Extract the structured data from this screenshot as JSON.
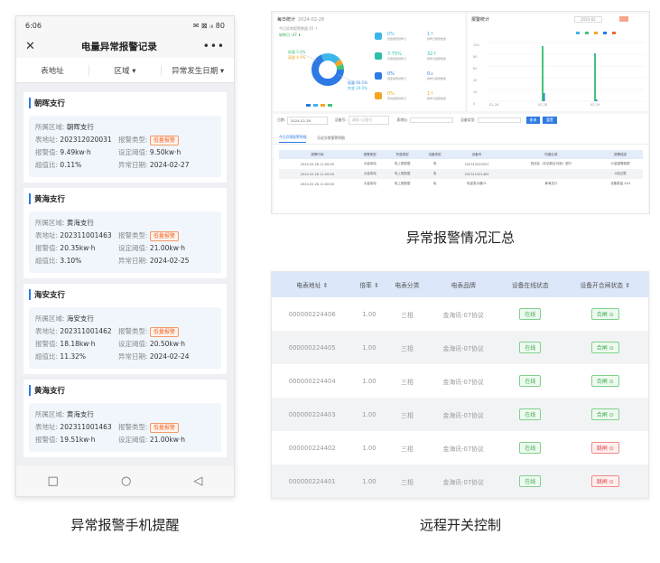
{
  "phone": {
    "status_time": "6:06",
    "status_icons": "✉ ⊠ ᵢₗₗ 80",
    "title": "电量异常报警记录",
    "close": "✕",
    "more": "•••",
    "filters": [
      "表地址",
      "区域 ▾",
      "异常发生日期 ▾"
    ],
    "labels": {
      "area": "所属区域:",
      "meter": "表地址:",
      "alarm_type": "报警类型:",
      "alarm_value": "报警值:",
      "threshold": "设定阈值:",
      "ratio": "超值比:",
      "date": "异常日期:"
    },
    "cards": [
      {
        "name": "朝晖支行",
        "area": "朝晖支行",
        "meter": "202312020031",
        "type": "低量报警",
        "value": "9.49kw·h",
        "threshold": "9.50kw·h",
        "ratio": "0.11%",
        "date": "2024-02-27"
      },
      {
        "name": "黄海支行",
        "area": "黄海支行",
        "meter": "202311001463",
        "type": "低量报警",
        "value": "20.35kw·h",
        "threshold": "21.00kw·h",
        "ratio": "3.10%",
        "date": "2024-02-25"
      },
      {
        "name": "海安支行",
        "area": "海安支行",
        "meter": "202311001462",
        "type": "低量报警",
        "value": "18.18kw·h",
        "threshold": "20.50kw·h",
        "ratio": "11.32%",
        "date": "2024-02-24"
      },
      {
        "name": "黄海支行",
        "area": "黄海支行",
        "meter": "202311001463",
        "type": "低量报警",
        "value": "19.51kw·h",
        "threshold": "21.00kw·h",
        "ratio": "",
        "date": ""
      }
    ],
    "nav": [
      "□",
      "○",
      "◁"
    ]
  },
  "captions": {
    "phone": "异常报警手机提醒",
    "dashboard": "异常报警情况汇总",
    "device": "远程开关控制"
  },
  "dashboard": {
    "left_title": "每日统计",
    "left_date": "2024-02-28",
    "summary_line": "今日异常报警数量 45 ↑",
    "summary_line2": "较昨日 -47 ⬇",
    "donut_labels": [
      "低量 5.0%",
      "高量 4.9%",
      "低量 60.1%",
      "突变 20.0%"
    ],
    "stats": [
      {
        "pct": "0%",
        "sub": "低量报警较昨日",
        "num": "1↑",
        "sub2": "较昨日报警数量"
      },
      {
        "pct": "7.75%",
        "sub": "高量报警较昨日",
        "num": "32↑",
        "sub2": "较昨日报警数量"
      },
      {
        "pct": "0%",
        "sub": "突变报警较昨日",
        "num": "0↓",
        "sub2": "较昨日报警数量"
      },
      {
        "pct": "0%",
        "sub": "离线报警较昨日",
        "num": "1↑",
        "sub2": "较昨日报警数量"
      }
    ],
    "right_title": "报警统计",
    "right_date": "2024-02",
    "bar_axis": [
      "100",
      "80",
      "60",
      "40",
      "20",
      "0"
    ],
    "bar_x": [
      "02-26",
      "02-28",
      "02-29"
    ],
    "filter_labels": [
      "日期:",
      "设备号:",
      "表地址:",
      "设备类型:"
    ],
    "filter_date": "2024-02-28",
    "filter_placeholder": "请输入设备号",
    "search_btn": "查询",
    "reset_btn": "重置",
    "tabs": [
      "今日异常报警明细",
      "历史异常报警明细"
    ],
    "table_headers": [
      "报警时间",
      "报警类型",
      "所属类型",
      "设备类型",
      "设备号",
      "所属区域",
      "报警描述"
    ],
    "table_rows": [
      [
        "2024-02-28 11:00:00",
        "大量用电",
        "电上报数据",
        "电",
        "202312020031",
        "西站区（北站新区对面）银行",
        "计量报警超限"
      ],
      [
        "2024-02-28 11:00:00",
        "大量用电",
        "电上报数据",
        "电",
        "202311001463",
        "",
        "A相过载"
      ],
      [
        "2024-02-28 11:00:00",
        "大量用电",
        "电上报数据",
        "电",
        "电量表示器01",
        "黄海支行",
        "设备数量 444"
      ]
    ]
  },
  "device": {
    "headers": [
      "电表地址 ⇕",
      "倍率 ⇕",
      "电表分类",
      "电表品牌",
      "设备在线状态",
      "设备开合闸状态 ⇕"
    ],
    "rows": [
      {
        "addr": "000000224406",
        "rate": "1.00",
        "cat": "三相",
        "brand": "金海讯-07协议",
        "online": "在线",
        "switch": "合闸 ⊙",
        "on": true
      },
      {
        "addr": "000000224405",
        "rate": "1.00",
        "cat": "三相",
        "brand": "金海讯-07协议",
        "online": "在线",
        "switch": "合闸 ⊙",
        "on": true
      },
      {
        "addr": "000000224404",
        "rate": "1.00",
        "cat": "三相",
        "brand": "金海讯-07协议",
        "online": "在线",
        "switch": "合闸 ⊙",
        "on": true
      },
      {
        "addr": "000000224403",
        "rate": "1.00",
        "cat": "三相",
        "brand": "金海讯-07协议",
        "online": "在线",
        "switch": "合闸 ⊙",
        "on": true
      },
      {
        "addr": "000000224402",
        "rate": "1.00",
        "cat": "三相",
        "brand": "金海讯-07协议",
        "online": "在线",
        "switch": "跳闸 ⊙",
        "on": false
      },
      {
        "addr": "000000224401",
        "rate": "1.00",
        "cat": "三相",
        "brand": "金海讯-07协议",
        "online": "在线",
        "switch": "跳闸 ⊙",
        "on": false
      }
    ]
  },
  "colors": {
    "accent": "#2d7ae5",
    "ok": "#3caa4e",
    "danger": "#e04848",
    "warn": "#f06a2a"
  }
}
